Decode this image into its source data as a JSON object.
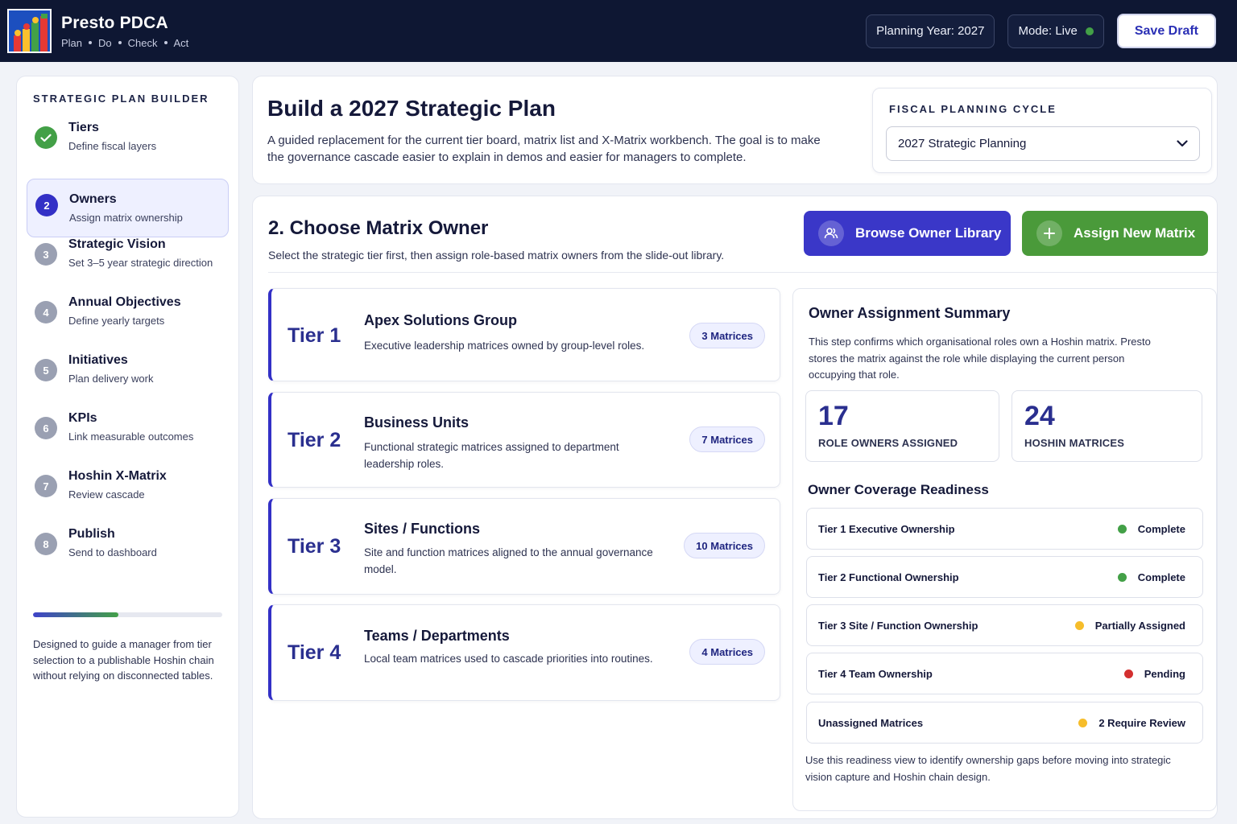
{
  "app": {
    "title": "Presto PDCA",
    "phases": [
      "Plan",
      "Do",
      "Check",
      "Act"
    ],
    "planning_year": "Planning Year: 2027",
    "mode": "Mode: Live",
    "mode_status_color": "#43a047",
    "save_label": "Save Draft"
  },
  "sidebar": {
    "heading": "STRATEGIC PLAN BUILDER",
    "steps": [
      {
        "num": "",
        "status": "done",
        "title": "Tiers",
        "subtitle": "Define fiscal layers"
      },
      {
        "num": "2",
        "status": "active",
        "title": "Owners",
        "subtitle": "Assign matrix ownership"
      },
      {
        "num": "3",
        "status": "todo",
        "title": "Strategic Vision",
        "subtitle": "Set 3–5 year strategic direction"
      },
      {
        "num": "4",
        "status": "todo",
        "title": "Annual Objectives",
        "subtitle": "Define yearly targets"
      },
      {
        "num": "5",
        "status": "todo",
        "title": "Initiatives",
        "subtitle": "Plan delivery work"
      },
      {
        "num": "6",
        "status": "todo",
        "title": "KPIs",
        "subtitle": "Link measurable outcomes"
      },
      {
        "num": "7",
        "status": "todo",
        "title": "Hoshin X-Matrix",
        "subtitle": "Review cascade"
      },
      {
        "num": "8",
        "status": "todo",
        "title": "Publish",
        "subtitle": "Send to dashboard"
      }
    ],
    "progress": 0.45,
    "note": "Designed to guide a manager from tier selection to a publishable Hoshin chain without relying on disconnected tables."
  },
  "intro": {
    "title": "Build a 2027 Strategic Plan",
    "description": "A guided replacement for the current tier board, matrix list and X-Matrix workbench. The goal is to make the governance cascade easier to explain in demos and easier for managers to complete.",
    "fiscal_label": "FISCAL PLANNING CYCLE",
    "fiscal_value": "2027 Strategic Planning"
  },
  "main": {
    "title": "2. Choose Matrix Owner",
    "subtitle": "Select the strategic tier first, then assign role-based matrix owners from the slide-out library.",
    "browse_label": "Browse Owner Library",
    "assign_label": "Assign New Matrix",
    "tiers": [
      {
        "name": "Tier 1",
        "title": "Apex Solutions Group",
        "description": "Executive leadership matrices owned by group-level roles.",
        "badge": "3 Matrices"
      },
      {
        "name": "Tier 2",
        "title": "Business Units",
        "description": "Functional strategic matrices assigned to department leadership roles.",
        "badge": "7 Matrices"
      },
      {
        "name": "Tier 3",
        "title": "Sites / Functions",
        "description": "Site and function matrices aligned to the annual governance model.",
        "badge": "10 Matrices"
      },
      {
        "name": "Tier 4",
        "title": "Teams / Departments",
        "description": "Local team matrices used to cascade priorities into routines.",
        "badge": "4 Matrices"
      }
    ]
  },
  "summary": {
    "title": "Owner Assignment Summary",
    "description": "This step confirms which organisational roles own a Hoshin matrix. Presto stores the matrix against the role while displaying the current person occupying that role.",
    "stats": [
      {
        "value": "17",
        "label": "ROLE OWNERS ASSIGNED"
      },
      {
        "value": "24",
        "label": "HOSHIN MATRICES"
      }
    ],
    "readiness_title": "Owner Coverage Readiness",
    "readiness": [
      {
        "label": "Tier 1 Executive Ownership",
        "status": "Complete",
        "color": "#43a047"
      },
      {
        "label": "Tier 2 Functional Ownership",
        "status": "Complete",
        "color": "#43a047"
      },
      {
        "label": "Tier 3 Site / Function Ownership",
        "status": "Partially Assigned",
        "color": "#f6bd2b"
      },
      {
        "label": "Tier 4 Team Ownership",
        "status": "Pending",
        "color": "#d32f2f"
      },
      {
        "label": "Unassigned Matrices",
        "status": "2 Require Review",
        "color": "#f6bd2b"
      }
    ],
    "footnote": "Use this readiness view to identify ownership gaps before moving into strategic vision capture and Hoshin chain design."
  }
}
